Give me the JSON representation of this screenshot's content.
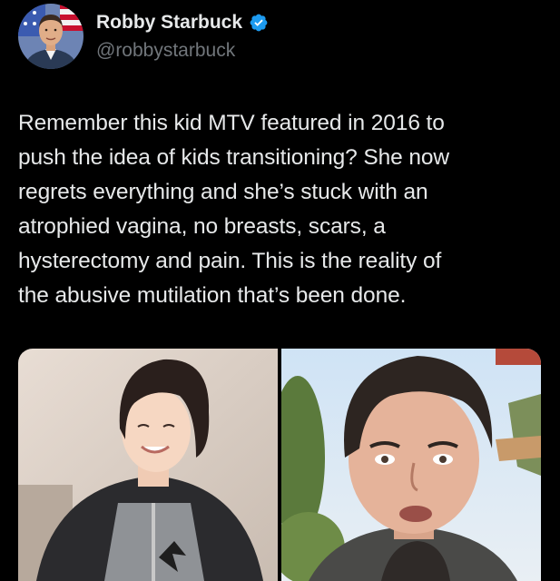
{
  "author": {
    "display_name": "Robby Starbuck",
    "handle": "@robbystarbuck",
    "verified": true,
    "verified_color": "#1d9bf0",
    "avatar_icon": "profile-photo"
  },
  "tweet": {
    "text": "Remember this kid MTV featured in 2016 to\npush the idea of kids transitioning? She now\nregrets everything and she’s stuck with an\natrophied vagina, no breasts, scars, a\nhysterectomy and pain. This is the reality of\nthe abusive mutilation that’s been done."
  },
  "media": [
    {
      "icon": "photo-teen-smiling"
    },
    {
      "icon": "photo-selfie-outdoor"
    }
  ],
  "colors": {
    "background": "#000000",
    "text_primary": "#e7e9ea",
    "text_secondary": "#71767b",
    "accent": "#1d9bf0"
  }
}
